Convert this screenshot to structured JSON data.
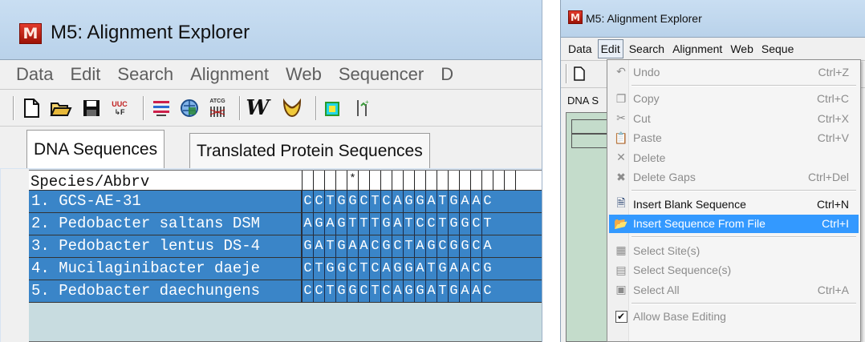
{
  "left": {
    "window_title": "M5: Alignment Explorer",
    "app_icon_letter": "M",
    "menu": [
      "Data",
      "Edit",
      "Search",
      "Alignment",
      "Web",
      "Sequencer",
      "D"
    ],
    "toolbar_icons": [
      "new-file-icon",
      "open-folder-icon",
      "save-icon",
      "translate-uuc-icon",
      "sequence-lines-icon",
      "web-query-icon",
      "atcg-icon",
      "w-align-icon",
      "muscle-icon",
      "sequence-star-icon",
      "merge-icon"
    ],
    "toolbar_text": {
      "translate_top": "UUC",
      "translate_bottom": "↳F",
      "atcg": "ATCG",
      "w": "W"
    },
    "tabs": [
      "DNA Sequences",
      "Translated Protein Sequences"
    ],
    "grid": {
      "species_header": "Species/Abbrv",
      "header_marks": [
        "",
        "",
        "",
        "",
        "*",
        "",
        "",
        "",
        "",
        "",
        "",
        "",
        "",
        "",
        "",
        "",
        "",
        "",
        "",
        ""
      ],
      "rows": [
        {
          "name": "1.  GCS-AE-31",
          "seq": "CCTGGCTCAGGATGAAC"
        },
        {
          "name": "2.  Pedobacter saltans DSM",
          "seq": "AGAGTTTGATCCTGGCT"
        },
        {
          "name": "3.  Pedobacter lentus DS-4",
          "seq": "GATGAACGCTAGCGGCA"
        },
        {
          "name": "4.  Mucilaginibacter daeje",
          "seq": "CTGGCTCAGGATGAACG"
        },
        {
          "name": "5.  Pedobacter daechungens",
          "seq": "CCTGGCTCAGGATGAAC"
        }
      ]
    }
  },
  "right": {
    "window_title": "M5: Alignment Explorer",
    "app_icon_letter": "M",
    "menu": [
      "Data",
      "Edit",
      "Search",
      "Alignment",
      "Web",
      "Seque"
    ],
    "tab_fragment": "DNA S",
    "edit_menu": [
      {
        "icon": "undo-icon",
        "glyph": "↶",
        "label": "Undo",
        "shortcut": "Ctrl+Z",
        "state": "disabled"
      },
      {
        "sep": true
      },
      {
        "icon": "copy-icon",
        "glyph": "❐",
        "label": "Copy",
        "shortcut": "Ctrl+C",
        "state": "disabled"
      },
      {
        "icon": "cut-icon",
        "glyph": "✂",
        "label": "Cut",
        "shortcut": "Ctrl+X",
        "state": "disabled"
      },
      {
        "icon": "paste-icon",
        "glyph": "📋",
        "label": "Paste",
        "shortcut": "Ctrl+V",
        "state": "disabled"
      },
      {
        "icon": "delete-icon",
        "glyph": "✕",
        "label": "Delete",
        "shortcut": "",
        "state": "disabled"
      },
      {
        "icon": "delete-gaps-icon",
        "glyph": "✖",
        "label": "Delete Gaps",
        "shortcut": "Ctrl+Del",
        "state": "disabled"
      },
      {
        "sep": true
      },
      {
        "icon": "insert-blank-sequence-icon",
        "glyph": "🗎",
        "label": "Insert Blank Sequence",
        "shortcut": "Ctrl+N",
        "state": "enabled"
      },
      {
        "icon": "insert-sequence-file-icon",
        "glyph": "📂",
        "label": "Insert Sequence From File",
        "shortcut": "Ctrl+I",
        "state": "highlighted"
      },
      {
        "sep": true
      },
      {
        "icon": "select-sites-icon",
        "glyph": "▦",
        "label": "Select Site(s)",
        "shortcut": "",
        "state": "disabled"
      },
      {
        "icon": "select-sequences-icon",
        "glyph": "▤",
        "label": "Select Sequence(s)",
        "shortcut": "",
        "state": "disabled"
      },
      {
        "icon": "select-all-icon",
        "glyph": "▣",
        "label": "Select All",
        "shortcut": "Ctrl+A",
        "state": "disabled"
      },
      {
        "sep": true
      },
      {
        "icon": "checkbox-icon",
        "glyph": "✔",
        "label": "Allow Base Editing",
        "shortcut": "",
        "state": "disabled",
        "checkbox": true
      }
    ]
  },
  "colors": {
    "selection_blue": "#3a85c8",
    "highlight_blue": "#3399ff",
    "grid_background": "#c8dce0",
    "title_gradient": "#c9def2"
  }
}
